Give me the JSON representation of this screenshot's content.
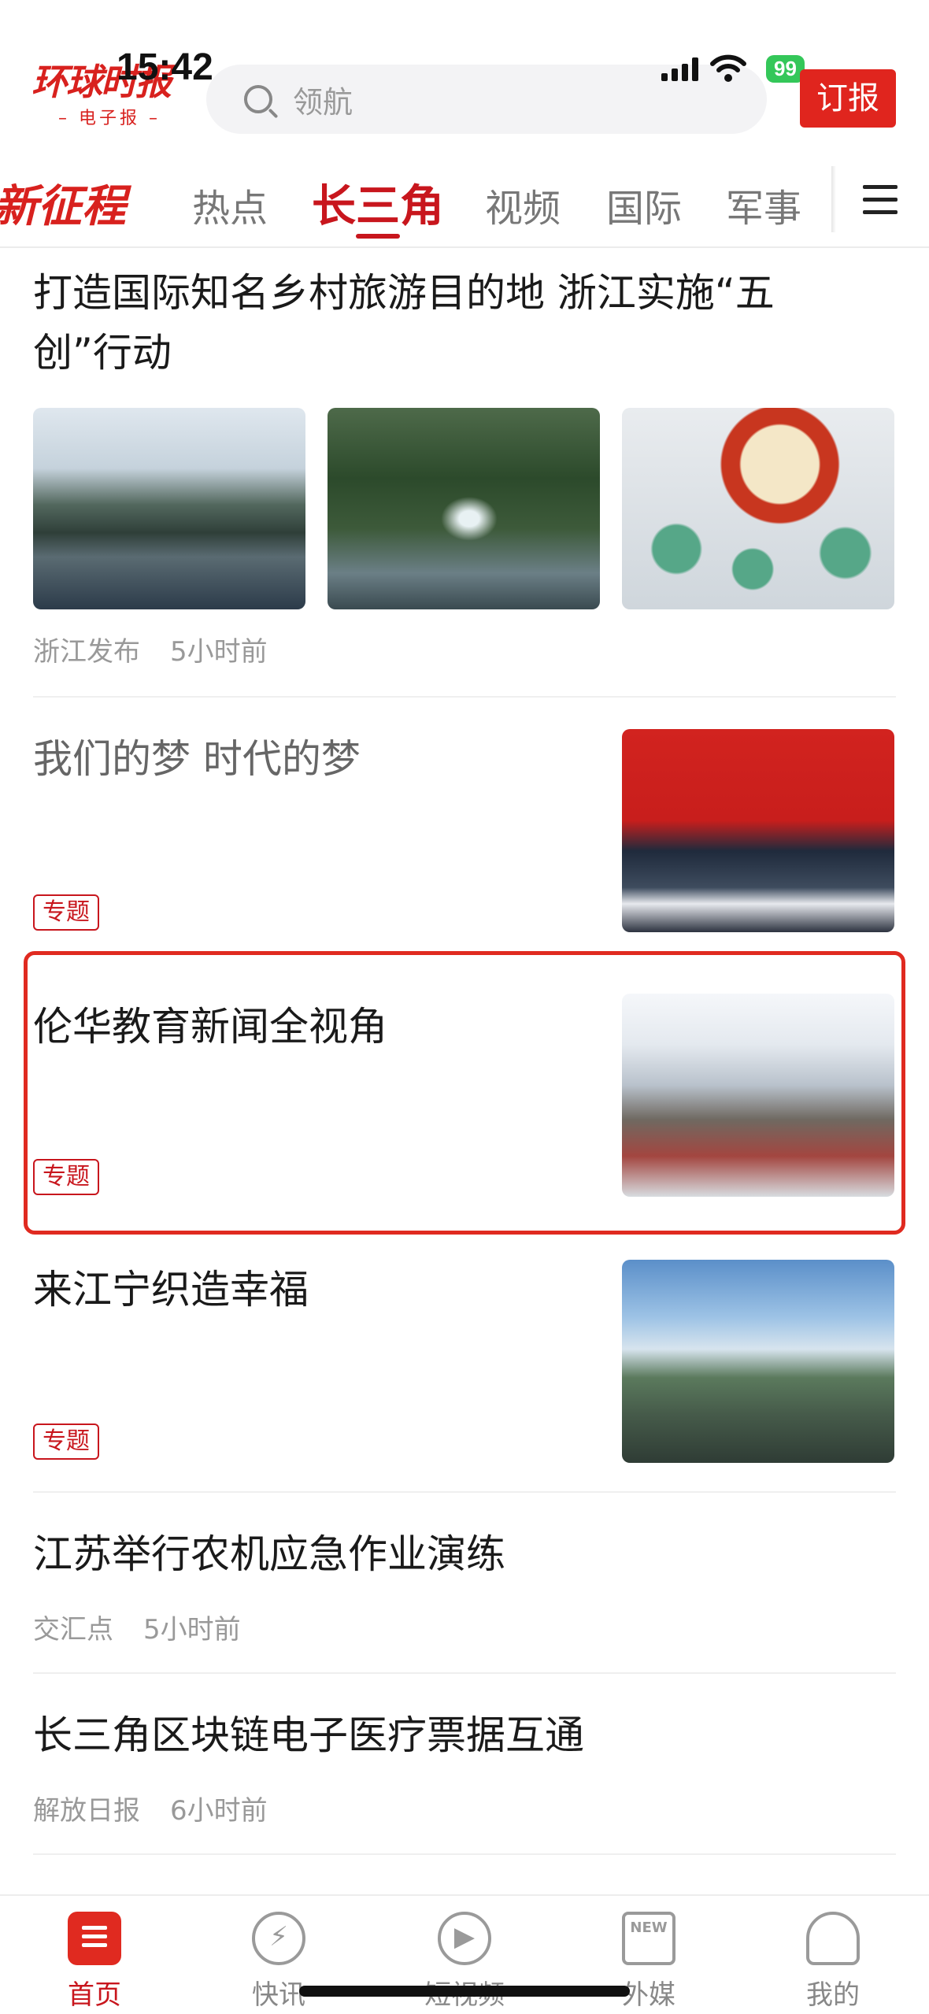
{
  "status_bar": {
    "time": "15:42",
    "battery": "99"
  },
  "header": {
    "logo_main": "环球时报",
    "logo_sub": "– 电子报 –",
    "search_placeholder": "领航",
    "subscribe_label": "订报"
  },
  "tabs": {
    "featured": "新征程",
    "items": [
      "热点",
      "长三角",
      "视频",
      "国际",
      "军事"
    ],
    "active_index": 1
  },
  "feed": [
    {
      "title_line1": "打造国际知名乡村旅游目的地 浙江实施“五",
      "title_line2": "创”行动",
      "source": "浙江发布",
      "time": "5小时前",
      "images": [
        "village-landscape",
        "waterfall",
        "ceramic-dishes"
      ]
    },
    {
      "title": "我们的梦 时代的梦",
      "tag": "专题",
      "image": "forum-stage-group-photo"
    },
    {
      "title": "伦华教育新闻全视角",
      "tag": "专题",
      "image": "school-group-photo",
      "highlighted": true
    },
    {
      "title": "来江宁织造幸福",
      "tag": "专题",
      "image": "city-aerial"
    },
    {
      "title": "江苏举行农机应急作业演练",
      "source": "交汇点",
      "time": "5小时前"
    },
    {
      "title": "长三角区块链电子医疗票据互通",
      "source": "解放日报",
      "time": "6小时前"
    }
  ],
  "bottom_nav": {
    "items": [
      {
        "label": "首页",
        "icon": "home-icon"
      },
      {
        "label": "快讯",
        "icon": "lightning-icon"
      },
      {
        "label": "短视频",
        "icon": "play-icon"
      },
      {
        "label": "外媒",
        "icon": "new-doc-icon",
        "icon_text": "NEW"
      },
      {
        "label": "我的",
        "icon": "user-icon"
      }
    ],
    "active_index": 0
  },
  "colors": {
    "brand_red": "#c8161d",
    "highlight_red": "#e02a20"
  }
}
